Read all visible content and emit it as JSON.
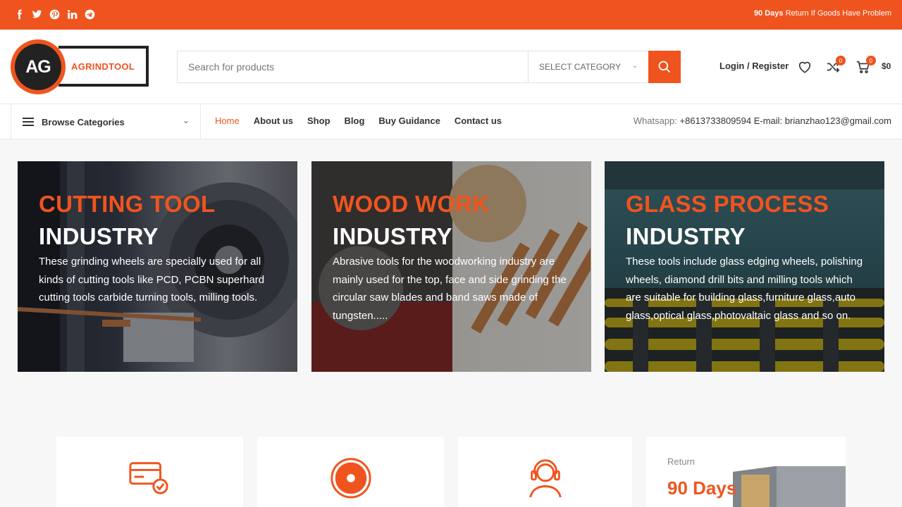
{
  "topbar": {
    "social_icons": [
      "facebook-icon",
      "twitter-icon",
      "pinterest-icon",
      "linkedin-icon",
      "telegram-icon"
    ],
    "promo_bold": "90 Days",
    "promo_text": " Return If Goods Have Problem"
  },
  "header": {
    "logo_mark": "AG",
    "logo_text": "AGRINDTOOL",
    "search_placeholder": "Search for products",
    "category_select": "SELECT CATEGORY",
    "login_label": "Login / Register",
    "wishlist_icon": "heart-icon",
    "compare_count": "0",
    "cart_count": "0",
    "cart_total": "$0"
  },
  "nav": {
    "browse_label": "Browse Categories",
    "items": [
      "Home",
      "About us",
      "Shop",
      "Blog",
      "Buy Guidance",
      "Contact us"
    ],
    "contact_prefix": "Whatsapp: ",
    "contact_value": "+8613733809594 E-mail: brianzhao123@gmail.com"
  },
  "banners": [
    {
      "line1": "CUTTING TOOL",
      "line2": "INDUSTRY",
      "text": "These grinding wheels are specially used for all kinds of cutting tools like PCD, PCBN superhard cutting tools carbide turning tools, milling tools."
    },
    {
      "line1": "WOOD WORK",
      "line2": "INDUSTRY",
      "text": "Abrasive tools for the woodworking industry are mainly used for the top, face and side grinding the circular saw blades and band saws made of tungsten....."
    },
    {
      "line1": "GLASS PROCESS",
      "line2": "INDUSTRY",
      "text": "These tools include glass edging wheels, polishing wheels, diamond drill bits and milling tools which are suitable for building glass,furniture glass,auto glass,optical glass,photovaltaic glass and so on."
    }
  ],
  "features": {
    "icons": [
      "payment-card-icon",
      "grinding-disc-icon",
      "support-headset-icon"
    ],
    "return_label": "Return",
    "return_value": "90 Days"
  },
  "colors": {
    "accent": "#f0541e",
    "dark": "#222222"
  }
}
